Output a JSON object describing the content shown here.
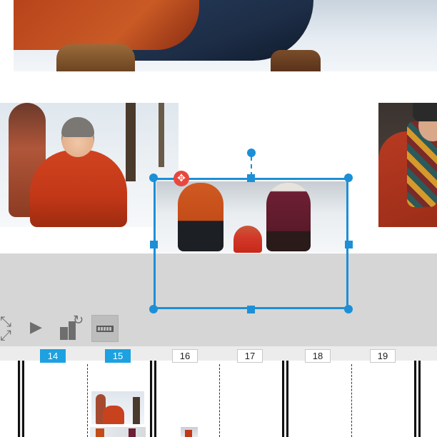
{
  "canvas": {
    "photos": [
      {
        "name": "top-photo"
      },
      {
        "name": "left-photo"
      },
      {
        "name": "right-photo"
      },
      {
        "name": "selected-photo"
      }
    ]
  },
  "toolbar": {
    "icons": [
      "collapse-arrows-icon",
      "play-icon",
      "swap-layout-icon",
      "ruler-icon"
    ]
  },
  "pages": {
    "tabs": [
      "14",
      "15",
      "16",
      "17",
      "18",
      "19"
    ],
    "active": [
      "14",
      "15"
    ]
  },
  "colors": {
    "selection": "#1d8fd6",
    "active_tab": "#1da1e0",
    "move_handle": "#e8473d",
    "workspace": "#d6d6d6"
  }
}
